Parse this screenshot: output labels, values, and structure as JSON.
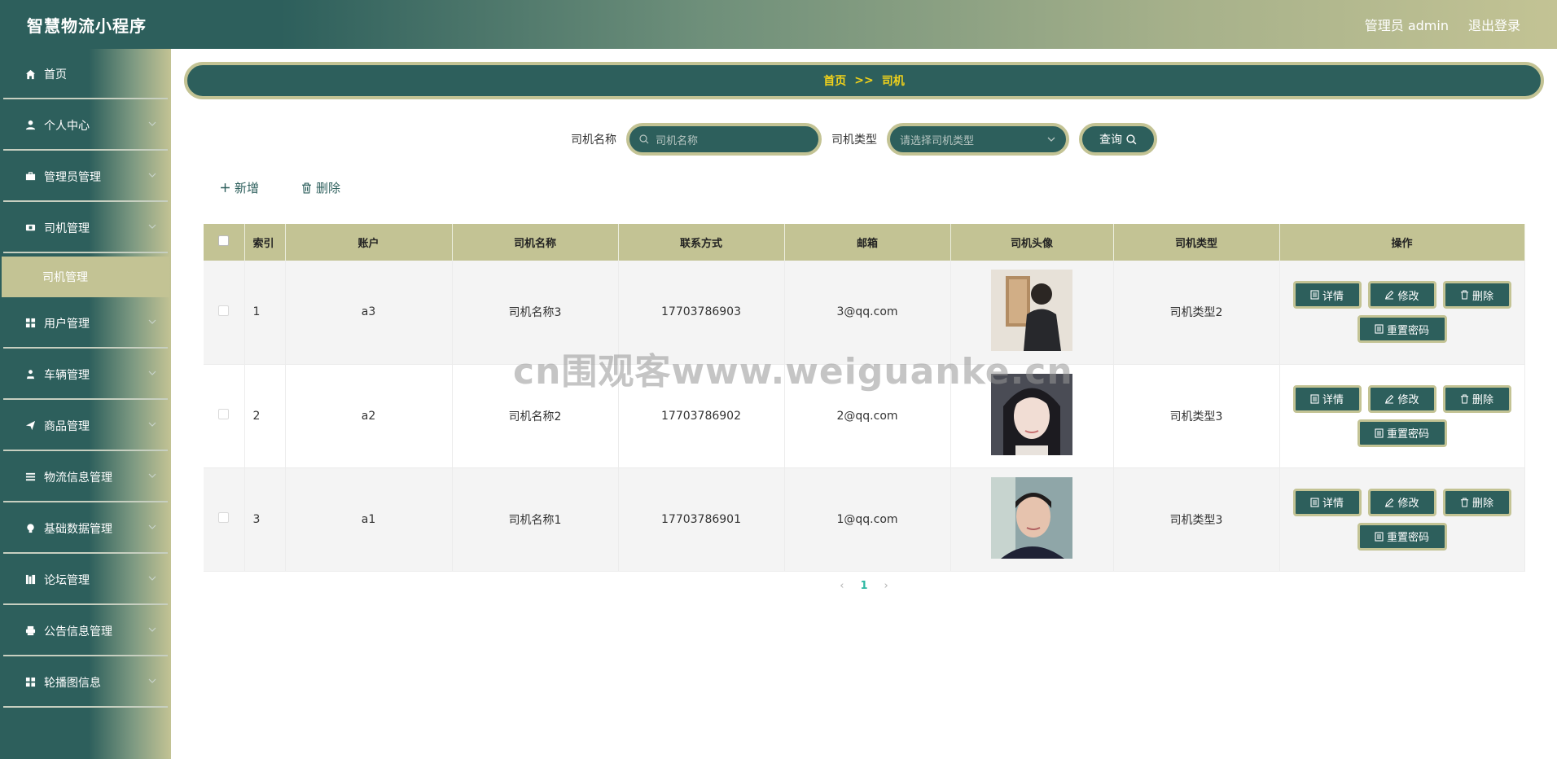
{
  "header": {
    "title": "智慧物流小程序",
    "user_label": "管理员 admin",
    "logout_label": "退出登录"
  },
  "sidebar": {
    "items": [
      {
        "label": "首页",
        "icon": "home-icon"
      },
      {
        "label": "个人中心",
        "icon": "user-icon"
      },
      {
        "label": "管理员管理",
        "icon": "briefcase-icon"
      },
      {
        "label": "司机管理",
        "icon": "driver-icon"
      },
      {
        "label": "用户管理",
        "icon": "grid-icon"
      },
      {
        "label": "车辆管理",
        "icon": "person-pin-icon"
      },
      {
        "label": "商品管理",
        "icon": "send-icon"
      },
      {
        "label": "物流信息管理",
        "icon": "list-icon"
      },
      {
        "label": "基础数据管理",
        "icon": "bulb-icon"
      },
      {
        "label": "论坛管理",
        "icon": "bookshelf-icon"
      },
      {
        "label": "公告信息管理",
        "icon": "printer-icon"
      },
      {
        "label": "轮播图信息",
        "icon": "grid-icon"
      }
    ],
    "submenu_driver": "司机管理"
  },
  "breadcrumb": {
    "home": "首页",
    "sep": ">>",
    "current": "司机"
  },
  "search": {
    "name_label": "司机名称",
    "name_placeholder": "司机名称",
    "type_label": "司机类型",
    "type_placeholder": "请选择司机类型",
    "query_label": "查询"
  },
  "actions": {
    "add": "新增",
    "delete": "删除"
  },
  "table": {
    "headers": [
      "索引",
      "账户",
      "司机名称",
      "联系方式",
      "邮箱",
      "司机头像",
      "司机类型",
      "操作"
    ],
    "rows": [
      {
        "index": "1",
        "account": "a3",
        "name": "司机名称3",
        "phone": "17703786903",
        "email": "3@qq.com",
        "type": "司机类型2"
      },
      {
        "index": "2",
        "account": "a2",
        "name": "司机名称2",
        "phone": "17703786902",
        "email": "2@qq.com",
        "type": "司机类型3"
      },
      {
        "index": "3",
        "account": "a1",
        "name": "司机名称1",
        "phone": "17703786901",
        "email": "1@qq.com",
        "type": "司机类型3"
      }
    ],
    "ops": {
      "detail": "详情",
      "edit": "修改",
      "delete": "删除",
      "reset": "重置密码"
    }
  },
  "pagination": {
    "current": "1",
    "prev": "‹",
    "next": "›"
  },
  "watermark": "cn围观客www.weiguanke.cn",
  "colors": {
    "primary": "#2d5f5c",
    "accent": "#c3c394",
    "breadcrumb_text": "#f2d21a"
  }
}
